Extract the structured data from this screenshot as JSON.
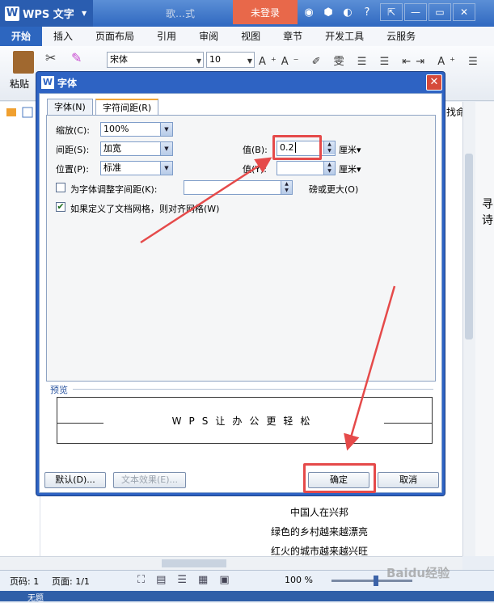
{
  "app": {
    "name": "WPS 文字",
    "logo_letter": "W",
    "doc_title": "歌…式",
    "login_label": "未登录"
  },
  "menu": [
    "开始",
    "插入",
    "页面布局",
    "引用",
    "审阅",
    "视图",
    "章节",
    "开发工具",
    "云服务"
  ],
  "ribbon": {
    "paste_label": "粘贴",
    "font_name": "宋体",
    "font_size": "10"
  },
  "side_text": {
    "a": "找命令",
    "b": "寻诗"
  },
  "document": {
    "lines": [
      "中国人在兴邦",
      "绿色的乡村越来越漂亮",
      "红火的城市越来越兴旺"
    ]
  },
  "status": {
    "page": "页码: 1",
    "pages": "页面: 1/1",
    "zoom": "100 %",
    "taskbar_text": "无题"
  },
  "dialog": {
    "title": "字体",
    "tabs": [
      "字体(N)",
      "字符间距(R)"
    ],
    "scale_label": "缩放(C):",
    "scale_value": "100%",
    "spacing_label": "间距(S):",
    "spacing_value": "加宽",
    "spacing_val_label": "值(B):",
    "spacing_val_value": "0.2",
    "position_label": "位置(P):",
    "position_value": "标准",
    "position_val_label": "值(Y):",
    "position_val_value": "",
    "unit": "厘米",
    "kerning_label": "为字体调整字间距(K):",
    "kerning_value": "",
    "kerning_suffix": "磅或更大(O)",
    "grid_label": "如果定义了文档网格，则对齐网格(W)",
    "preview_label": "预览",
    "preview_text": "WPS让办公更轻松",
    "default_btn": "默认(D)...",
    "effects_btn": "文本效果(E)...",
    "ok_btn": "确定",
    "cancel_btn": "取消"
  },
  "watermark": "Baidu经验"
}
